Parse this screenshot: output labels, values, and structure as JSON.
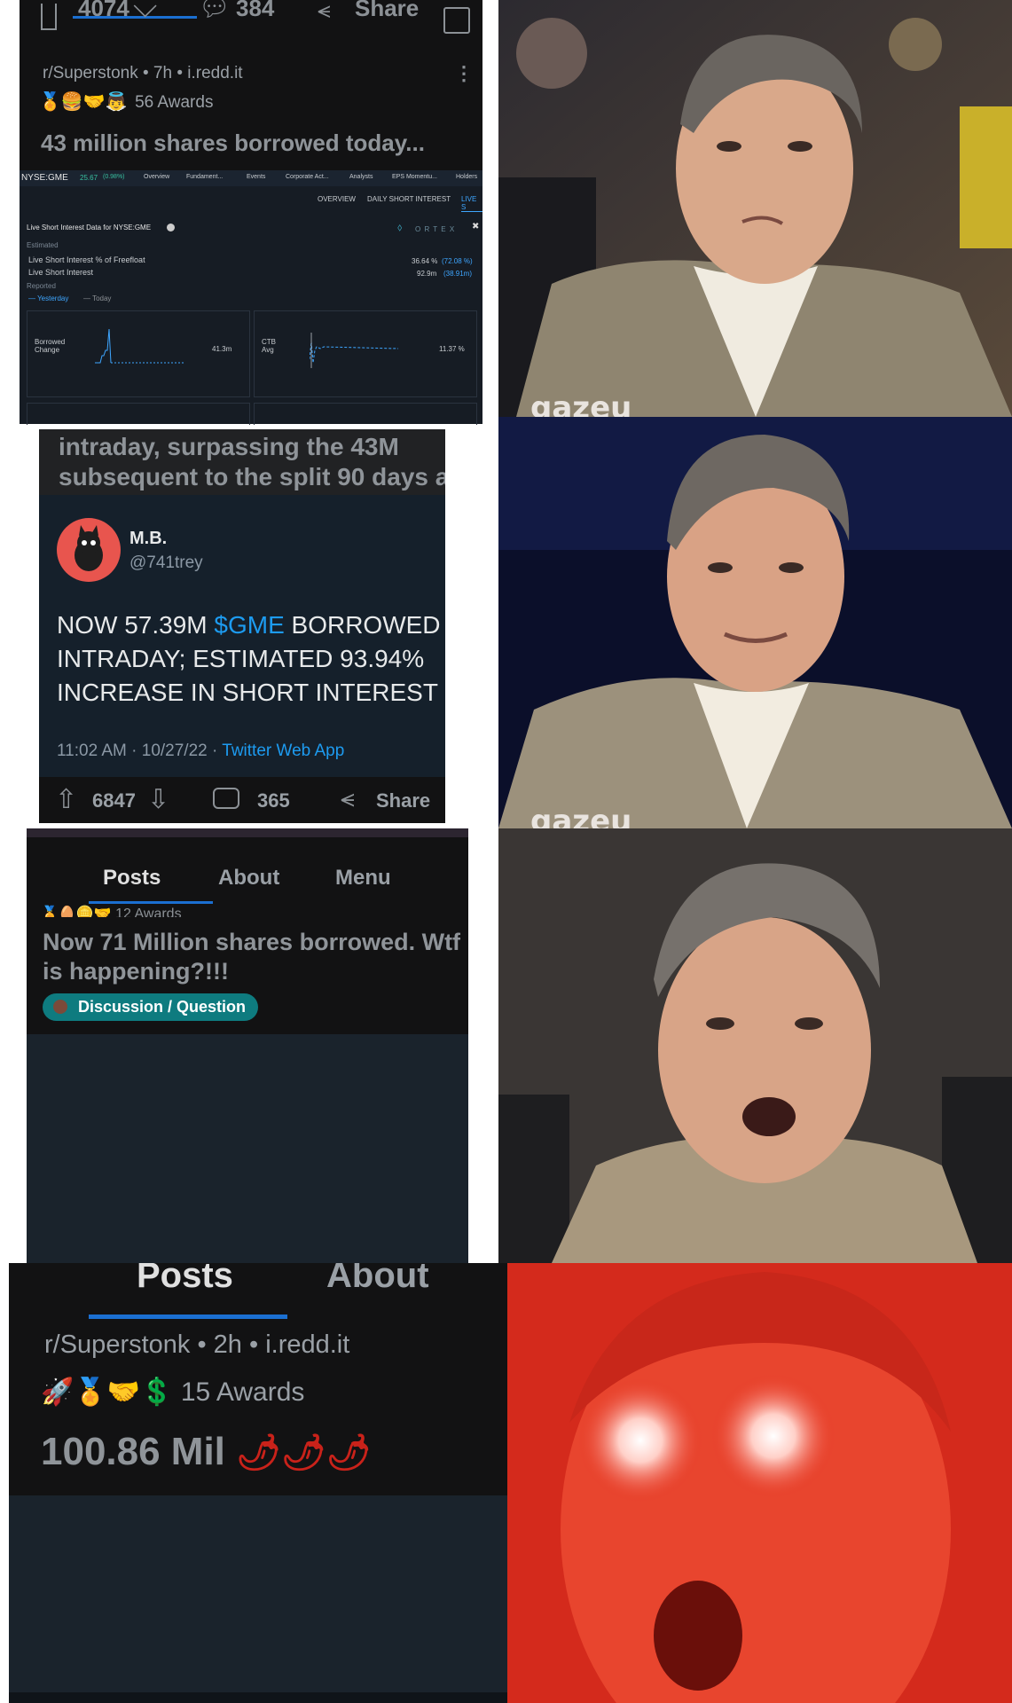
{
  "panel1": {
    "top_votes": "4074",
    "top_comments": "384",
    "top_share": "Share",
    "meta": "r/Superstonk • 7h • i.redd.it",
    "awards": "56 Awards",
    "title": "43 million shares borrowed today...",
    "ortex": {
      "ticker": "NYSE:GME",
      "price": "25.67",
      "change": "(0.98%)",
      "tabs": [
        "Overview",
        "Fundament...",
        "Events",
        "Corporate Act...",
        "Analysts",
        "EPS Momentu...",
        "Holders"
      ],
      "subtabs": [
        "OVERVIEW",
        "DAILY SHORT INTEREST",
        "LIVE S"
      ],
      "header": "Live Short Interest Data for NYSE:GME",
      "brand": "O R T E X",
      "estimated": "Estimated",
      "row1_label": "Live Short Interest % of Freefloat",
      "row1_value": "36.64 %",
      "row1_prev": "(72.08 %)",
      "row2_label": "Live Short Interest",
      "row2_value": "92.9m",
      "row2_prev": "(38.91m)",
      "reported": "Reported",
      "legend_yesterday": "Yesterday",
      "legend_today": "Today",
      "mini1_label": "Borrowed Change",
      "mini1_value": "41.3m",
      "mini2_label": "CTB Avg",
      "mini2_value": "11.37 %"
    }
  },
  "panel2": {
    "post_text_line1": "intraday, surpassing the 43M",
    "post_text_line2": "subsequent to the split 90 days a",
    "name": "M.B.",
    "handle": "@741trey",
    "tweet_pre": "NOW 57.39M ",
    "tweet_cashtag": "$GME",
    "tweet_post1": " BORROWED",
    "tweet_line2": "INTRADAY; ESTIMATED 93.94%",
    "tweet_line3": "INCREASE IN SHORT INTEREST (!",
    "timestamp": "11:02 AM · 10/27/22 · ",
    "source": "Twitter Web App",
    "votes": "6847",
    "comments": "365",
    "share": "Share"
  },
  "panel3": {
    "tabs": [
      "Posts",
      "About",
      "Menu"
    ],
    "awards": "12 Awards",
    "title": "Now 71 Million shares borrowed. Wtf is happening?!!!",
    "title_line1": "Now 71 Million shares borrowed. Wtf",
    "title_line2": "is happening?!!!",
    "flair": "Discussion / Question"
  },
  "panel4": {
    "tabs": [
      "Posts",
      "About"
    ],
    "meta": "r/Superstonk • 2h • i.redd.it",
    "awards": "15 Awards",
    "title": "100.86 Mil",
    "emoji": "🌶🌶🌶"
  },
  "watermarks": [
    "gazeu",
    "gazeu"
  ],
  "colors": {
    "reddit_bg": "#121213",
    "tweet_bg": "#15202b",
    "link_blue": "#1d9bf0",
    "tab_underline": "#1b6fd1",
    "flair": "#0e7b7f",
    "red_glow": "#e8331f"
  }
}
